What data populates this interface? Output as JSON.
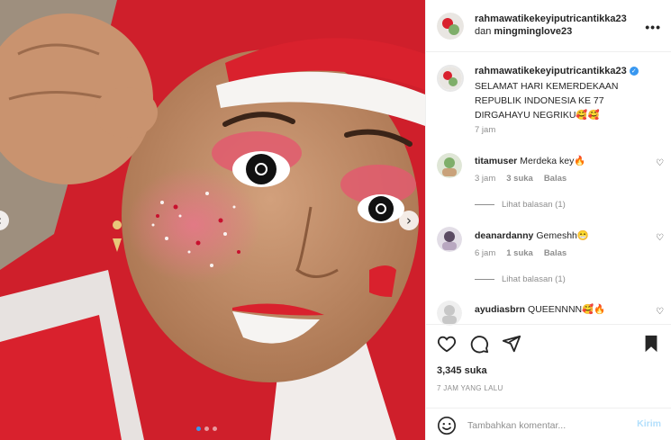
{
  "post": {
    "header": {
      "username": "rahmawatikekeyiputricantikka23",
      "collab_word": "dan",
      "collab_user": "mingminglove23",
      "more_label": "•••"
    },
    "caption": {
      "username": "rahmawatikekeyiputricantikka23",
      "verified_icon": "verified-badge-icon",
      "text": "SELAMAT HARI KEMERDEKAAN REPUBLIK INDONESIA KE 77 DIRGAHAYU NEGRIKU🥰🥰",
      "time": "7 jam"
    },
    "comments": [
      {
        "username": "titamuser",
        "text": "Merdeka key🔥",
        "time": "3 jam",
        "likes": "3 suka",
        "reply": "Balas",
        "view_replies": "Lihat balasan (1)"
      },
      {
        "username": "deanardanny",
        "text": "Gemeshh😁",
        "time": "6 jam",
        "likes": "1 suka",
        "reply": "Balas",
        "view_replies": "Lihat balasan (1)"
      },
      {
        "username": "ayudiasbrn",
        "text": "QUEENNNN🥰🔥"
      }
    ],
    "likes": "3,345 suka",
    "posted": "7 JAM YANG LALU",
    "add_comment": {
      "placeholder": "Tambahkan komentar...",
      "send_label": "Kirim"
    }
  },
  "icons": {
    "like": "heart-icon",
    "comment": "comment-icon",
    "share": "paper-plane-icon",
    "save": "bookmark-icon",
    "emoji": "smiley-icon",
    "carousel_prev": "chevron-left-icon",
    "carousel_next": "chevron-right-icon"
  },
  "carousel": {
    "slide": 1,
    "total": 3
  },
  "colors": {
    "accent_blue": "#3897f0",
    "send_disabled": "#b2dffc",
    "muted": "#8e8e8e",
    "flag_red": "#d9212d"
  }
}
